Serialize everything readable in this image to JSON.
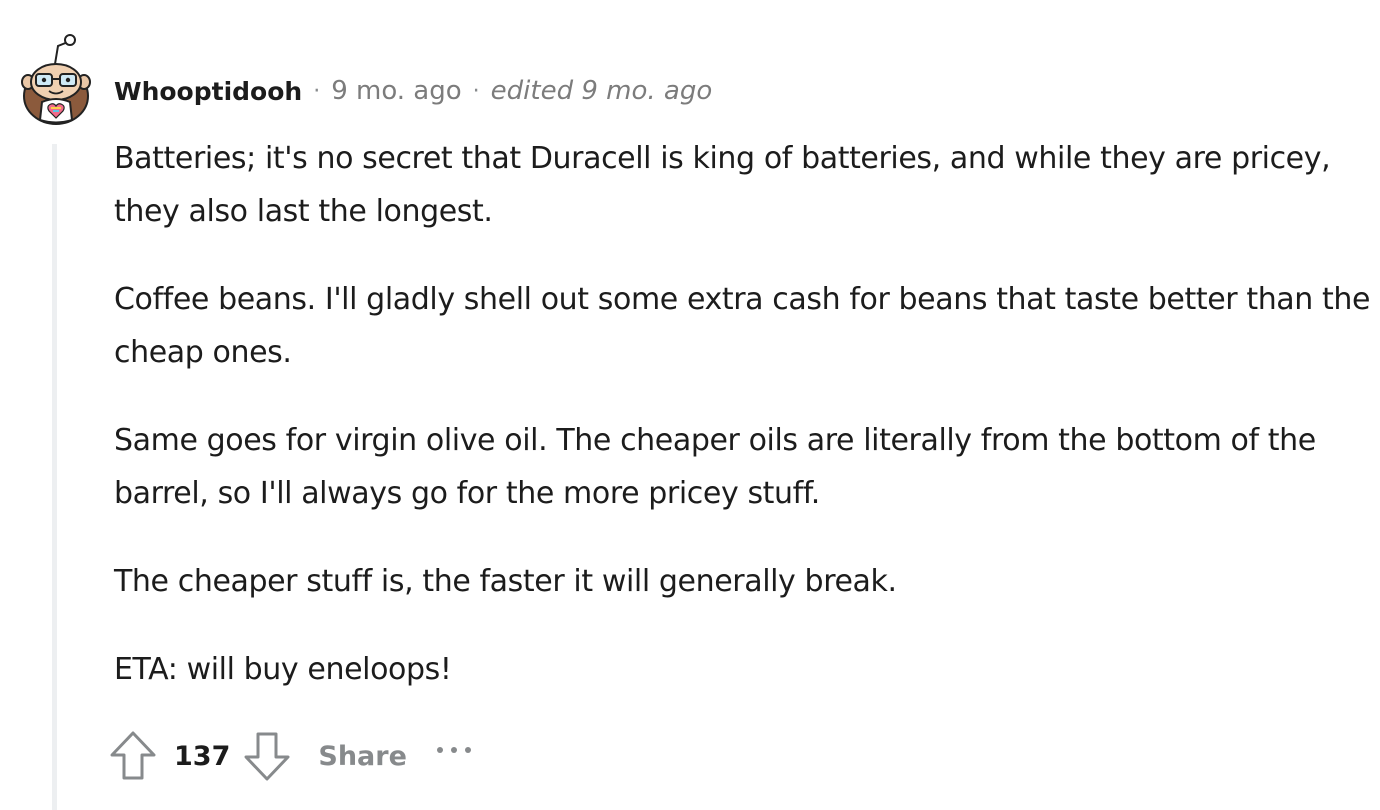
{
  "comment": {
    "username": "Whooptidooh",
    "separator": "·",
    "time": "9 mo. ago",
    "edited": "edited 9 mo. ago",
    "paragraphs": [
      "Batteries; it's no secret that Duracell is king of batteries, and while they are pricey, they also last the longest.",
      "Coffee beans. I'll gladly shell out some extra cash for beans that taste better than the cheap ones.",
      "Same goes for virgin olive oil. The cheaper oils are literally from the bottom of the barrel, so I'll always go for the more pricey stuff.",
      "The cheaper stuff is, the faster it will generally break.",
      "ETA: will buy eneloops!"
    ]
  },
  "actions": {
    "score": "137",
    "share_label": "Share"
  },
  "icons": {
    "avatar": "snoo-avatar-icon",
    "upvote": "arrow-up-icon",
    "downvote": "arrow-down-icon",
    "more": "more-options-icon"
  }
}
